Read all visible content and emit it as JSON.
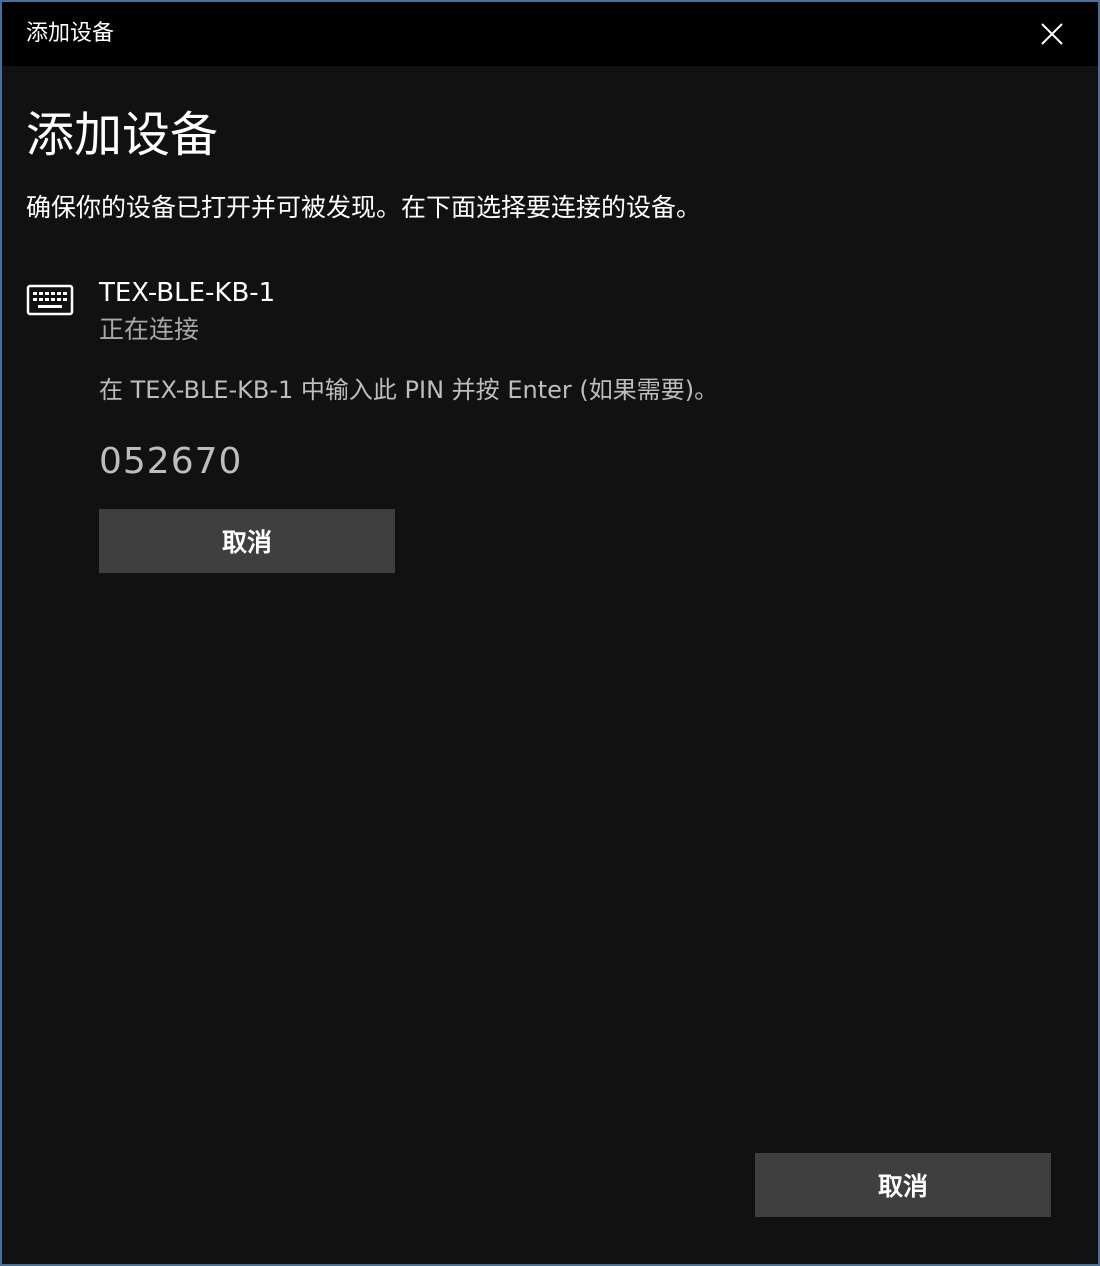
{
  "window": {
    "title": "添加设备"
  },
  "content": {
    "heading": "添加设备",
    "instructions": "确保你的设备已打开并可被发现。在下面选择要连接的设备。"
  },
  "device": {
    "icon": "keyboard-icon",
    "name": "TEX-BLE-KB-1",
    "status": "正在连接",
    "pin_instruction": "在 TEX-BLE-KB-1 中输入此 PIN 并按 Enter (如果需要)。",
    "pin": "052670",
    "cancel_label": "取消"
  },
  "footer": {
    "cancel_label": "取消"
  },
  "colors": {
    "background": "#111111",
    "titlebar": "#000000",
    "button": "#3f3f3f",
    "secondary_text": "#a8a8a8"
  }
}
